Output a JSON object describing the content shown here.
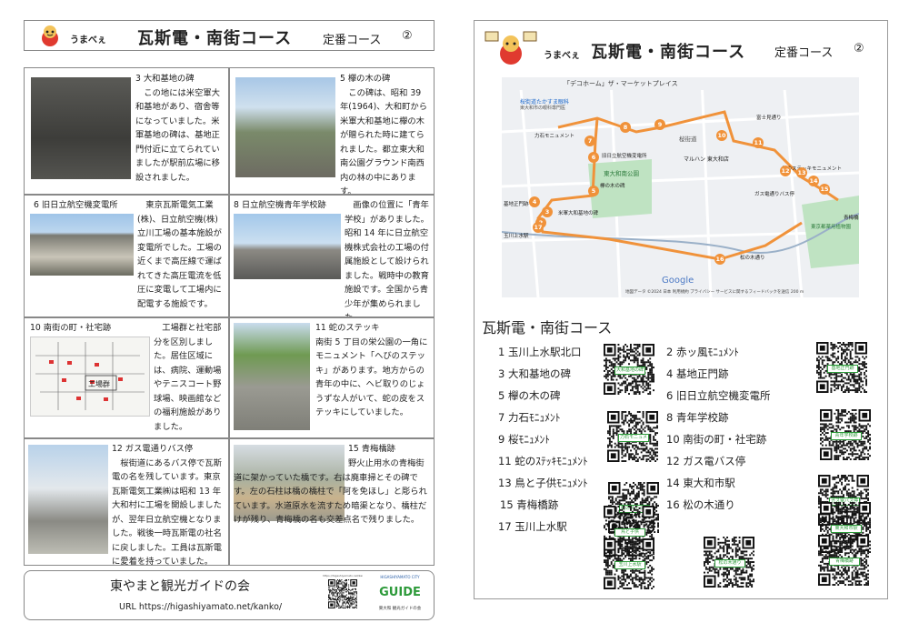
{
  "header": {
    "mascot_name": "うまべぇ",
    "title": "瓦斯電・南街コース",
    "subtitle": "定番コース",
    "number": "②"
  },
  "spots_cells": [
    {
      "title": "3 大和基地の碑",
      "text": "この地には米空軍大和基地があり、宿舎等になっていました。米軍基地の碑は、基地正門付近に立てられていましたが駅前広場に移設されました。"
    },
    {
      "title": "5 欅の木の碑",
      "text": "この碑は、昭和 39 年(1964)、大和町から米軍大和基地に欅の木が贈られた時に建てられました。都立東大和南公園グラウンド南西内の林の中にあります。"
    },
    {
      "title": "6 旧日立航空機変電所",
      "text": "東京瓦斯電気工業(株)、日立航空機(株)立川工場の基本施設が変電所でした。工場の近くまで高圧線で運ばれてきた高圧電流を低圧に変電して工場内に配電する施設です。"
    },
    {
      "title": "8 日立航空機青年学校跡",
      "text": "画像の位置に「青年学校」がありました。昭和 14 年に日立航空機株式会社の工場の付属施設として設けられました。戦時中の教育施設です。全国から青少年が集められました。"
    },
    {
      "title": "10 南街の町・社宅跡",
      "text": "工場群と社宅部分を区別しました。居住区域には、病院、運動場やテニスコート野球場、映画館などの福利施設がありました。",
      "map_label": "工場群"
    },
    {
      "title": "11 蛇のステッキ",
      "text": "南街 5 丁目の栄公園の一角にモニュメント「へびのステッキ」があります。地方からの青年の中に、ヘビ取りのじょうずな人がいて、蛇の皮をステッキにしていました。"
    },
    {
      "title": "12 ガス電通りバス停",
      "text": "桜街道にあるバス停で瓦斯電の名を残しています。東京瓦斯電気工業㈱は昭和 13 年大和村に工場を開設しましたが、翌年日立航空機となりました。戦後一時瓦斯電の社名に戻しました。工員は瓦斯電に愛着を持っていました。"
    },
    {
      "title": "15 青梅橋跡",
      "text": "野火止用水の青梅街道に架かっていた橋です。右は廃車掃とその碑です。左の石柱は橋の橋柱で「阿を免ほし」と彫られています。水道原水を流すため暗渠となり、橋柱だけが残り、青梅橋の名も交差点名で残りました。"
    }
  ],
  "footer": {
    "org": "東やまと観光ガイドの会",
    "url": "URL https://higashiyamato.net/kanko/",
    "qr_caption": "https://higashiyamato.net/kanko/",
    "logo_top": "HIGASHIYAMATO CITY",
    "logo_text": "GUIDE",
    "logo_bottom": "東大和 観光ガイドの会"
  },
  "map": {
    "banner": "「デコホーム」ザ・マーケットプレイス",
    "labels": {
      "clinic": "桜街道たかすま眼科",
      "clinic2": "東大和市の眼科専門医",
      "monument7": "力石モニュメント",
      "substation": "旧日立航空機変電所",
      "park": "東大和南公園",
      "keyaki": "欅の木の碑",
      "gate": "基地正門跡",
      "base": "米軍大和基地の碑",
      "station": "玉川上水駅",
      "sakura": "桜街道",
      "maruhan": "マルハン 東大和店",
      "stick": "蛇のステッキモニュメント",
      "bus": "ガス電通りバス停",
      "ome": "青梅橋",
      "herb": "東京都薬用植物園",
      "matsu": "松の木通り",
      "road": "富士見通り",
      "google": "Google",
      "credits": "地図データ ©2024 日本 利用規約 プライバシー サービスに関するフィードバックを送信 200 m"
    },
    "route_points": [
      "2",
      "3",
      "4",
      "5",
      "6",
      "7",
      "8",
      "9",
      "10",
      "11",
      "12",
      "13",
      "14",
      "15",
      "16",
      "17"
    ]
  },
  "qr_section": {
    "title": "瓦斯電・南街コース",
    "items": [
      "1 玉川上水駅北口",
      "2 赤ッ風ﾓﾆｭﾒﾝﾄ",
      "3 大和基地の碑",
      "4 基地正門跡",
      "5 欅の木の碑",
      "6 旧日立航空機変電所",
      "7 力石ﾓﾆｭﾒﾝﾄ",
      "8 青年学校跡",
      "9 桜ﾓﾆｭﾒﾝﾄ",
      "10 南街の町・社宅跡",
      "11 蛇のｽﾃｯｷﾓﾆｭﾒﾝﾄ",
      "12 ガス電バス停",
      "13 鳥と子供ﾓﾆｭﾒﾝﾄ",
      "14 東大和市駅",
      "15 青梅橋跡",
      "16 松の木通り",
      "17 玉川上水駅"
    ],
    "qr_labels": [
      "大和基地の碑",
      "基地正門跡",
      "力石モニュメント",
      "青年学校跡",
      "蛇のステッキ",
      "ガス電バス停",
      "鳥と子供",
      "東大和市駅",
      "玉川上水駅",
      "松の木通り",
      "青梅橋跡"
    ]
  },
  "colors": {
    "route": "#f0923a",
    "park": "#bfe3c2",
    "qr_accent": "#2d9a3a",
    "mascot_red": "#e03a2f"
  }
}
